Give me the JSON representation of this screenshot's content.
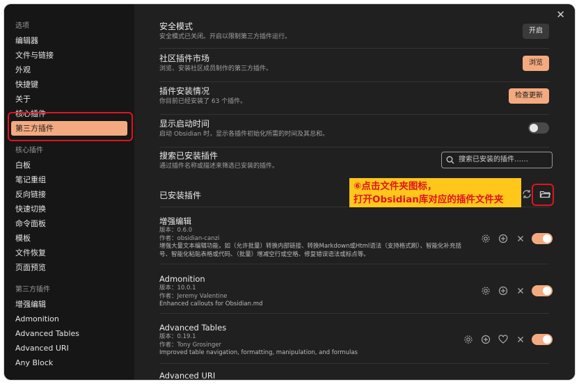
{
  "sidebar": {
    "group1": "选项",
    "options": [
      "编辑器",
      "文件与链接",
      "外观",
      "快捷键",
      "关于",
      "核心插件",
      "第三方插件"
    ],
    "group2": "核心插件",
    "core": [
      "白板",
      "笔记重组",
      "反向链接",
      "快速切换",
      "命令面板",
      "模板",
      "文件恢复",
      "页面预览"
    ],
    "group3": "第三方插件",
    "third": [
      "增强编辑",
      "Admonition",
      "Advanced Tables",
      "Advanced URI",
      "Any Block"
    ]
  },
  "settings": {
    "safe_mode": {
      "name": "安全模式",
      "desc": "安全模式已关闭。开启以限制第三方插件运行。",
      "button": "开启"
    },
    "market": {
      "name": "社区插件市场",
      "desc": "浏览、安装社区成员制作的第三方插件。",
      "button": "浏览"
    },
    "installed_status": {
      "name": "插件安装情况",
      "desc": "你目前已经安装了 63 个插件。",
      "button": "检查更新"
    },
    "startup_time": {
      "name": "显示启动时间",
      "desc": "启动 Obsidian 时，显示各插件初始化所需的时间及其总和。"
    },
    "search_installed": {
      "name": "搜索已安装插件",
      "desc": "通过插件名称或描述来筛选已安装的插件。",
      "placeholder": "搜索已安装的插件……"
    },
    "installed_header": "已安装插件"
  },
  "annotation": {
    "line1": "⑥点击文件夹图标，",
    "line2": "打开Obsidian库对应的插件文件夹"
  },
  "plugins": [
    {
      "name": "增强编辑",
      "version": "版本：0.6.0",
      "author": "作者：obsidian-canzi",
      "desc": "增强大量文本编辑功能，如（允许批量）转换内部链接、转换Markdown或Html语法（支持格式刷）、智能化补充括号、智能化粘贴表格或代码、（批量）增减空行或空格、修复错误语法或标点等。",
      "enabled": true
    },
    {
      "name": "Admonition",
      "version": "版本：10.0.1",
      "author": "作者：Jeremy Valentine",
      "desc": "Enhanced callouts for Obsidian.md",
      "enabled": true
    },
    {
      "name": "Advanced Tables",
      "version": "版本：0.19.1",
      "author": "作者：Tony Grosinger",
      "desc": "Improved table navigation, formatting, manipulation, and formulas",
      "enabled": true
    },
    {
      "name": "Advanced URI",
      "version": "",
      "author": "",
      "desc": ""
    }
  ],
  "colors": {
    "accent": "#f3aa80",
    "highlight": "#e0141e",
    "annotation_bg": "#ffc71a"
  }
}
